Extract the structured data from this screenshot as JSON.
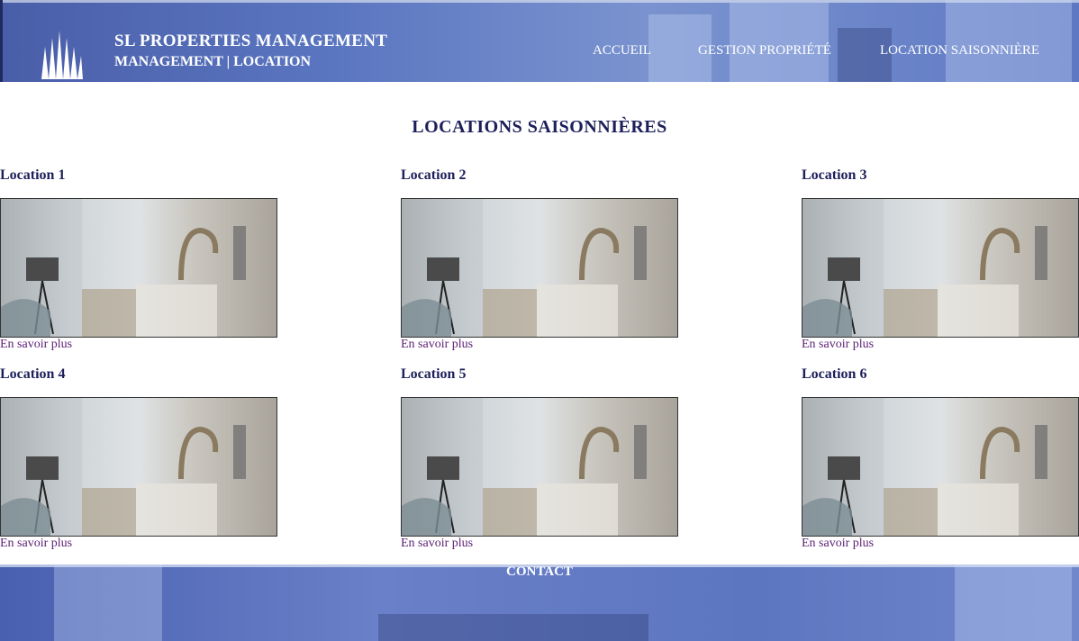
{
  "header": {
    "brand_title": "SL PROPERTIES MANAGEMENT",
    "brand_subtitle": "MANAGEMENT | LOCATION",
    "nav": [
      {
        "label": "ACCUEIL"
      },
      {
        "label": "GESTION PROPRIÉTÉ"
      },
      {
        "label": "LOCATION SAISONNIÈRE"
      }
    ]
  },
  "main": {
    "title": "LOCATIONS SAISONNIÈRES",
    "listings": [
      {
        "title": "Location 1",
        "link": "En savoir plus"
      },
      {
        "title": "Location 2",
        "link": "En savoir plus"
      },
      {
        "title": "Location 3",
        "link": "En savoir plus"
      },
      {
        "title": "Location 4",
        "link": "En savoir plus"
      },
      {
        "title": "Location 5",
        "link": "En savoir plus"
      },
      {
        "title": "Location 6",
        "link": "En savoir plus"
      }
    ]
  },
  "footer": {
    "contact": "CONTACT"
  },
  "colors": {
    "header_blue": "#5a75c0",
    "title_navy": "#1c1f5a",
    "link_purple": "#5a1e72"
  }
}
